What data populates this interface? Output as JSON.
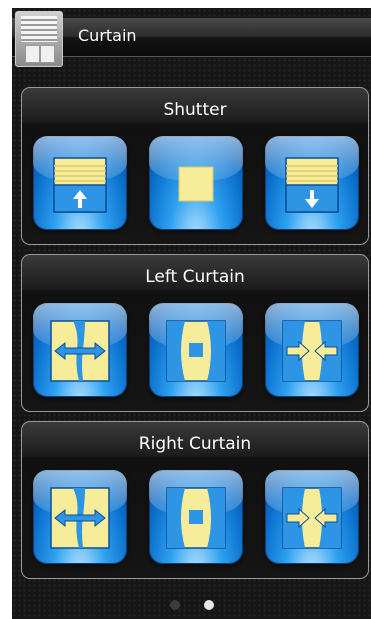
{
  "header": {
    "title": "Curtain",
    "icon": "window-blind-icon"
  },
  "panels": [
    {
      "title": "Shutter",
      "buttons": [
        {
          "action": "Shutter up",
          "icon": "shutter-up-icon"
        },
        {
          "action": "Shutter stop",
          "icon": "shutter-stop-icon"
        },
        {
          "action": "Shutter down",
          "icon": "shutter-down-icon"
        }
      ]
    },
    {
      "title": "Left Curtain",
      "buttons": [
        {
          "action": "Left curtain open",
          "icon": "curtain-open-icon"
        },
        {
          "action": "Left curtain stop",
          "icon": "curtain-stop-icon"
        },
        {
          "action": "Left curtain close",
          "icon": "curtain-close-icon"
        }
      ]
    },
    {
      "title": "Right Curtain",
      "buttons": [
        {
          "action": "Right curtain open",
          "icon": "curtain-open-icon"
        },
        {
          "action": "Right curtain stop",
          "icon": "curtain-stop-icon"
        },
        {
          "action": "Right curtain close",
          "icon": "curtain-close-icon"
        }
      ]
    }
  ],
  "pager": {
    "pages": 2,
    "current": 2
  },
  "colors": {
    "accent": "#1e90e8",
    "icon_fill": "#f6ec9a",
    "background": "#161616"
  }
}
